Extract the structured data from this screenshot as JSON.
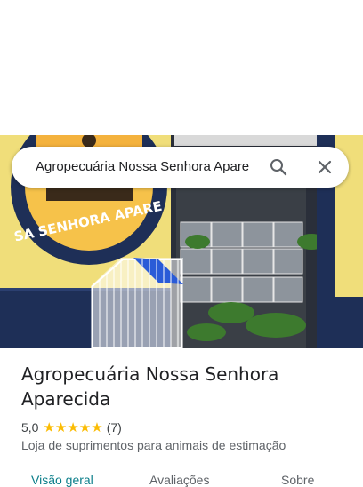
{
  "search": {
    "query": "Agropecuária Nossa Senhora Apare"
  },
  "photo": {
    "sign_text": "SA SENHORA APARE"
  },
  "place": {
    "title": "Agropecuária Nossa Senhora Aparecida",
    "rating": "5,0",
    "review_count": "(7)",
    "stars": "★★★★★",
    "category": "Loja de suprimentos para animais de estimação"
  },
  "tabs": [
    {
      "label": "Visão geral",
      "active": true
    },
    {
      "label": "Avaliações",
      "active": false
    },
    {
      "label": "Sobre",
      "active": false
    }
  ],
  "colors": {
    "accent": "#0b7e8a",
    "star": "#fbbc04",
    "wall_yellow": "#f0de7a",
    "wall_blue": "#1e2f57"
  },
  "icons": {
    "search": "search-icon",
    "close": "close-icon"
  }
}
